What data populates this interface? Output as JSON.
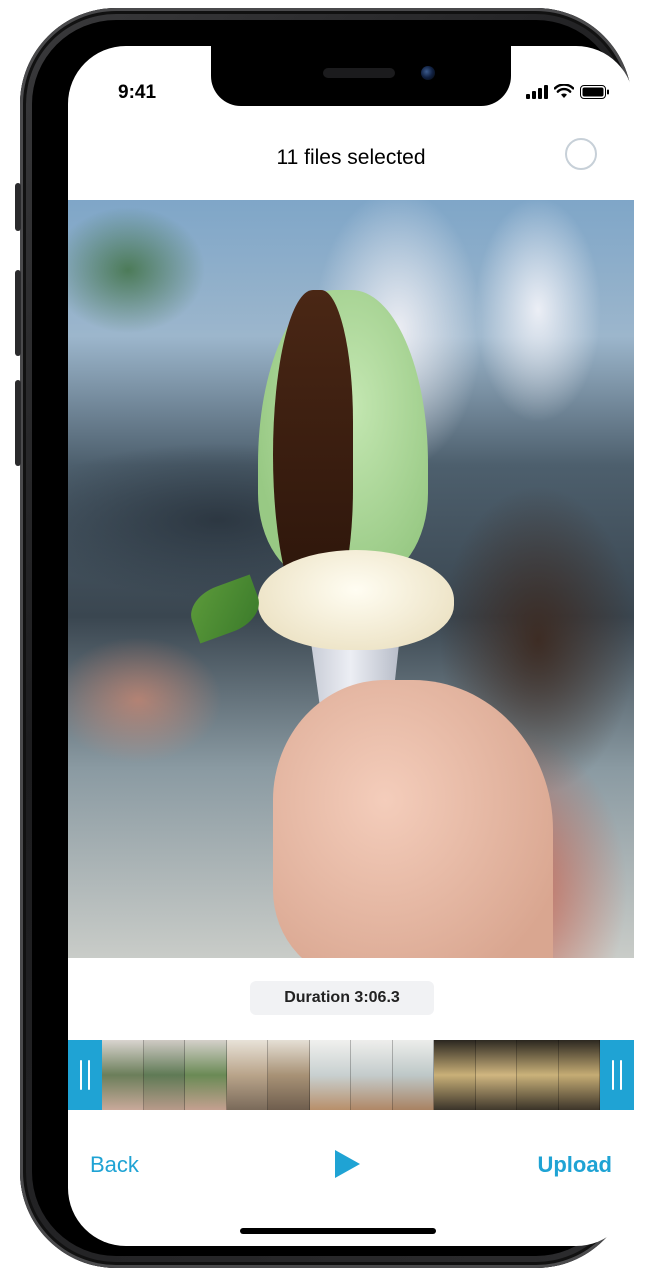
{
  "status_bar": {
    "time": "9:41"
  },
  "header": {
    "title": "11 files selected"
  },
  "preview": {
    "image_semantic": "ice-cream-cone-photo"
  },
  "duration": {
    "label": "Duration 3:06.3"
  },
  "timeline": {
    "thumbnails": [
      {
        "colors": [
          "#d9d4cf",
          "#6b7e5a",
          "#c9a99a"
        ]
      },
      {
        "colors": [
          "#cfcac4",
          "#5f7a55",
          "#b89a8a"
        ]
      },
      {
        "colors": [
          "#d4d0ca",
          "#6a8a55",
          "#c4a090"
        ]
      },
      {
        "colors": [
          "#e8e2d8",
          "#b9a48a",
          "#7a6a5a"
        ]
      },
      {
        "colors": [
          "#e5dfd5",
          "#a89276",
          "#6f5e4e"
        ]
      },
      {
        "colors": [
          "#f0f0ee",
          "#c8d0d0",
          "#b88f6a"
        ]
      },
      {
        "colors": [
          "#eeeeec",
          "#c4cccc",
          "#b08766"
        ]
      },
      {
        "colors": [
          "#ecedeb",
          "#bec8c8",
          "#a98262"
        ]
      },
      {
        "colors": [
          "#2a2620",
          "#c9b078",
          "#3b342a"
        ]
      },
      {
        "colors": [
          "#2e2a22",
          "#d0b680",
          "#40382c"
        ]
      },
      {
        "colors": [
          "#2a261f",
          "#cab27a",
          "#3a3328"
        ]
      },
      {
        "colors": [
          "#2c2821",
          "#c5ac74",
          "#3d352a"
        ]
      }
    ],
    "accent": "#1fa3d4"
  },
  "controls": {
    "back_label": "Back",
    "upload_label": "Upload",
    "play_icon": "play-icon"
  },
  "colors": {
    "accent": "#1fa3d4",
    "text": "#000000",
    "chip_bg": "#f1f2f4"
  }
}
